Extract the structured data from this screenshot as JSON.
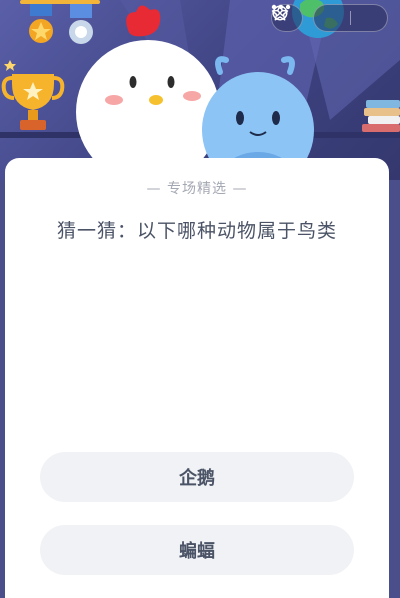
{
  "header": {
    "icons": [
      "medal-icon",
      "gear-medal-icon",
      "trophy-icon",
      "star-icon",
      "more-icon",
      "close-icon"
    ]
  },
  "quiz": {
    "section_label": "— 专场精选 —",
    "question": "猜一猜：以下哪种动物属于鸟类",
    "options": [
      {
        "label": "企鹅"
      },
      {
        "label": "蝙蝠"
      }
    ]
  },
  "colors": {
    "hero_bg": "#4a4f8c",
    "card_bg": "#ffffff",
    "option_bg": "#f1f2f5",
    "text": "#4b5366",
    "muted": "#a4a8b3"
  }
}
